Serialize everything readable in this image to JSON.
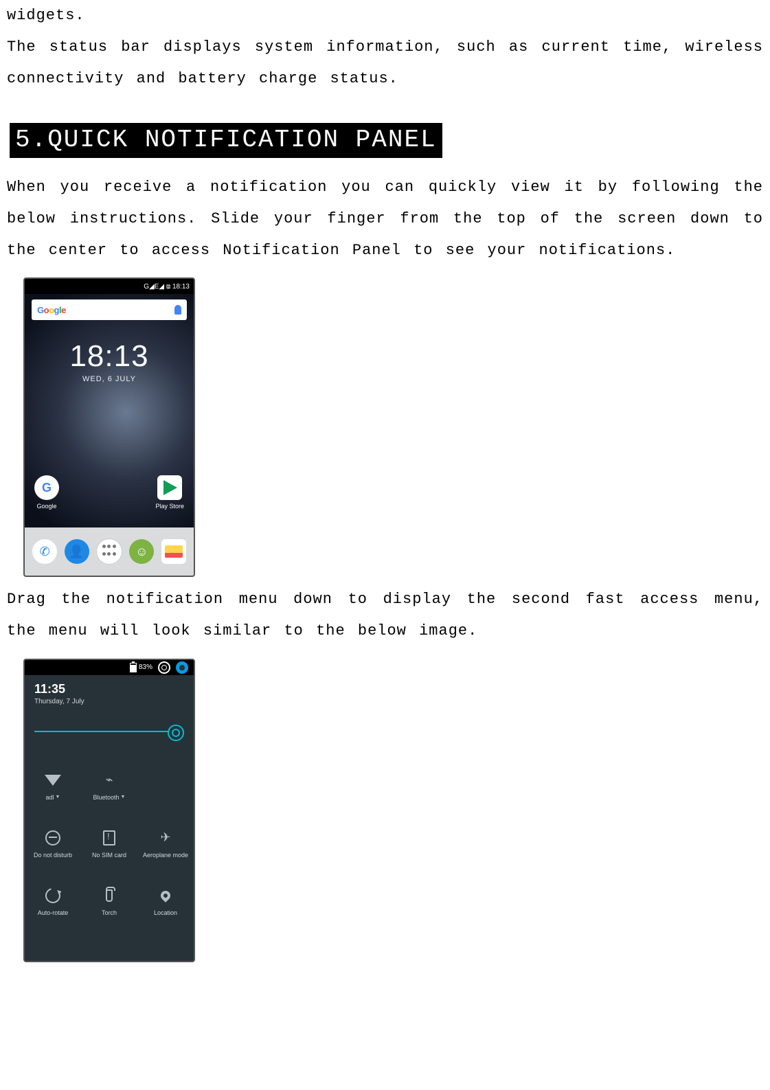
{
  "intro": {
    "line1": "widgets.",
    "line2": "The status bar displays system information, such as current time, wireless connectivity and battery charge status."
  },
  "section": {
    "heading": "5.QUICK NOTIFICATION PANEL"
  },
  "para_after_heading": "When you receive a notification you can quickly view it by following the below instructions. Slide your finger from the top of the screen down to the center to access Notification Panel to see your notifications.",
  "para_between": "Drag the notification menu down to display the second fast access menu, the menu will look similar to the below image.",
  "phone1": {
    "status_text": "G◢E◢ ⧈ 18:13",
    "search_brand_letters": [
      "G",
      "o",
      "o",
      "g",
      "l",
      "e"
    ],
    "clock_time": "18:13",
    "clock_date": "WED, 6 JULY",
    "apps": {
      "google": "Google",
      "playstore": "Play Store"
    }
  },
  "phone2": {
    "battery_pct": "83%",
    "time": "11:35",
    "date": "Thursday, 7 July",
    "tiles": [
      {
        "label": "adl",
        "dropdown": true
      },
      {
        "label": "Bluetooth",
        "dropdown": true
      },
      {
        "label": "",
        "empty": true
      },
      {
        "label": "Do not disturb"
      },
      {
        "label": "No SIM card"
      },
      {
        "label": "Aeroplane mode"
      },
      {
        "label": "Auto-rotate"
      },
      {
        "label": "Torch"
      },
      {
        "label": "Location"
      }
    ]
  }
}
